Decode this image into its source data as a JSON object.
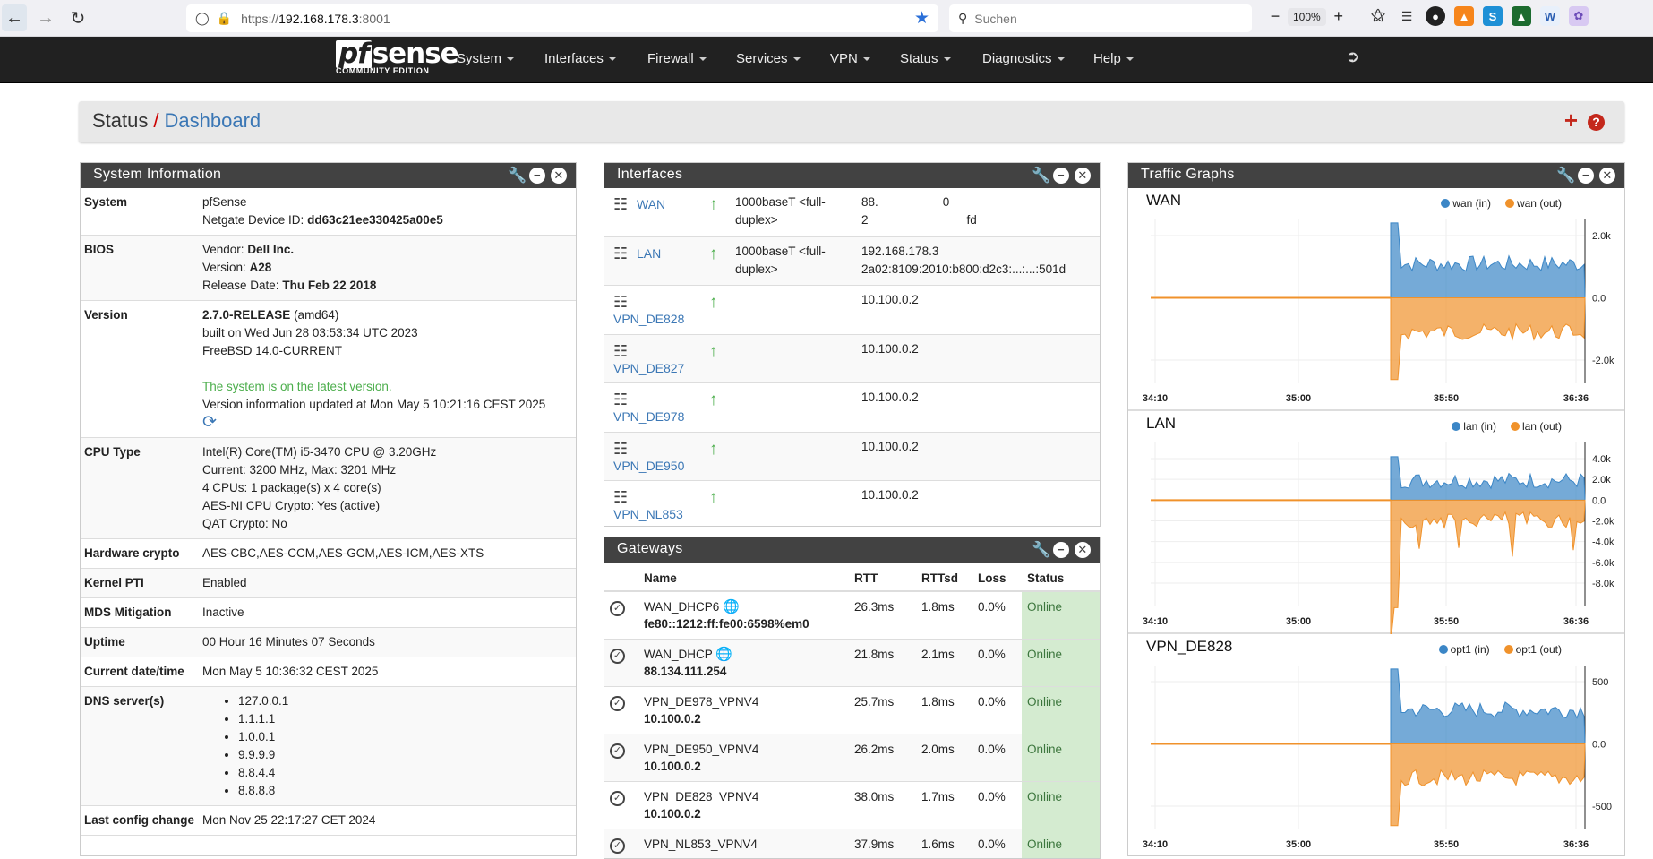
{
  "browser": {
    "url_scheme": "https://",
    "url_host": "192.168.178.3",
    "url_port": ":8001",
    "search_placeholder": "Suchen",
    "zoom": "100%"
  },
  "nav": {
    "logo_main": "sense",
    "logo_pf": "pf",
    "logo_sub": "COMMUNITY EDITION",
    "menus": [
      "System",
      "Interfaces",
      "Firewall",
      "Services",
      "VPN",
      "Status",
      "Diagnostics",
      "Help"
    ]
  },
  "breadcrumb": {
    "section": "Status",
    "separator": "/",
    "page": "Dashboard"
  },
  "sysinfo": {
    "title": "System Information",
    "system_label": "System",
    "system_name": "pfSense",
    "device_id_label": "Netgate Device ID:",
    "device_id": "dd63c21ee330425a00e5",
    "bios_label": "BIOS",
    "bios_vendor_label": "Vendor:",
    "bios_vendor": "Dell Inc.",
    "bios_version_label": "Version:",
    "bios_version": "A28",
    "bios_date_label": "Release Date:",
    "bios_date": "Thu Feb 22 2018",
    "version_label": "Version",
    "version_release": "2.7.0-RELEASE",
    "version_arch": "(amd64)",
    "version_built": "built on Wed Jun 28 03:53:34 UTC 2023",
    "version_os": "FreeBSD 14.0-CURRENT",
    "version_latest": "The system is on the latest version.",
    "version_updated": "Version information updated at Mon May 5 10:21:16 CEST 2025",
    "cpu_label": "CPU Type",
    "cpu_model": "Intel(R) Core(TM) i5-3470 CPU @ 3.20GHz",
    "cpu_freq": "Current: 3200 MHz, Max: 3201 MHz",
    "cpu_cores": "4 CPUs: 1 package(s) x 4 core(s)",
    "cpu_aesni": "AES-NI CPU Crypto: Yes (active)",
    "cpu_qat": "QAT Crypto: No",
    "hwcrypto_label": "Hardware crypto",
    "hwcrypto": "AES-CBC,AES-CCM,AES-GCM,AES-ICM,AES-XTS",
    "pti_label": "Kernel PTI",
    "pti": "Enabled",
    "mds_label": "MDS Mitigation",
    "mds": "Inactive",
    "uptime_label": "Uptime",
    "uptime": "00 Hour 16 Minutes 07 Seconds",
    "datetime_label": "Current date/time",
    "datetime": "Mon May 5 10:36:32 CEST 2025",
    "dns_label": "DNS server(s)",
    "dns": [
      "127.0.0.1",
      "1.1.1.1",
      "1.0.0.1",
      "9.9.9.9",
      "8.8.4.4",
      "8.8.8.8"
    ],
    "lastconfig_label": "Last config change",
    "lastconfig": "Mon Nov 25 22:17:27 CET 2024"
  },
  "interfaces": {
    "title": "Interfaces",
    "rows": [
      {
        "name": "WAN",
        "media1": "1000baseT <full-",
        "media2": "duplex>",
        "ip1": "88.",
        "ip1b": "0",
        "ip2": "2",
        "ip2b": "fd"
      },
      {
        "name": "LAN",
        "media1": "1000baseT <full-",
        "media2": "duplex>",
        "ip1": "192.168.178.3",
        "ip2": "2a02:8109:2010:b800:d2c3:...:...:501d"
      },
      {
        "name": "VPN_DE828",
        "ip1": "10.100.0.2"
      },
      {
        "name": "VPN_DE827",
        "ip1": "10.100.0.2"
      },
      {
        "name": "VPN_DE978",
        "ip1": "10.100.0.2"
      },
      {
        "name": "VPN_DE950",
        "ip1": "10.100.0.2"
      },
      {
        "name": "VPN_NL853",
        "ip1": "10.100.0.2"
      }
    ]
  },
  "gateways": {
    "title": "Gateways",
    "headers": [
      "Name",
      "RTT",
      "RTTsd",
      "Loss",
      "Status"
    ],
    "rows": [
      {
        "name": "WAN_DHCP6",
        "addr": "fe80::1212:ff:fe00:6598%em0",
        "rtt": "26.3ms",
        "rttsd": "1.8ms",
        "loss": "0.0%",
        "status": "Online",
        "globe": true
      },
      {
        "name": "WAN_DHCP",
        "addr": "88.134.111.254",
        "rtt": "21.8ms",
        "rttsd": "2.1ms",
        "loss": "0.0%",
        "status": "Online",
        "globe": true
      },
      {
        "name": "VPN_DE978_VPNV4",
        "addr": "10.100.0.2",
        "rtt": "25.7ms",
        "rttsd": "1.8ms",
        "loss": "0.0%",
        "status": "Online"
      },
      {
        "name": "VPN_DE950_VPNV4",
        "addr": "10.100.0.2",
        "rtt": "26.2ms",
        "rttsd": "2.0ms",
        "loss": "0.0%",
        "status": "Online"
      },
      {
        "name": "VPN_DE828_VPNV4",
        "addr": "10.100.0.2",
        "rtt": "38.0ms",
        "rttsd": "1.7ms",
        "loss": "0.0%",
        "status": "Online"
      },
      {
        "name": "VPN_NL853_VPNV4",
        "addr": "",
        "rtt": "37.9ms",
        "rttsd": "1.6ms",
        "loss": "0.0%",
        "status": "Online"
      }
    ]
  },
  "traffic": {
    "title": "Traffic Graphs",
    "colors": {
      "in": "#3b86c6",
      "out": "#f0922b"
    },
    "graphs": [
      {
        "name": "WAN",
        "legend_in": "wan (in)",
        "legend_out": "wan (out)",
        "yticks": [
          "2.0k",
          "0.0",
          "-2.0k"
        ],
        "xticks": [
          "34:10",
          "35:00",
          "35:50",
          "36:36"
        ]
      },
      {
        "name": "LAN",
        "legend_in": "lan (in)",
        "legend_out": "lan (out)",
        "yticks": [
          "4.0k",
          "2.0k",
          "0.0",
          "-2.0k",
          "-4.0k",
          "-6.0k",
          "-8.0k"
        ],
        "xticks": [
          "34:10",
          "35:00",
          "35:50",
          "36:36"
        ]
      },
      {
        "name": "VPN_DE828",
        "legend_in": "opt1 (in)",
        "legend_out": "opt1 (out)",
        "yticks": [
          "500",
          "0.0",
          "-500"
        ],
        "xticks": [
          "34:10",
          "35:00",
          "35:50",
          "36:36"
        ]
      }
    ]
  }
}
